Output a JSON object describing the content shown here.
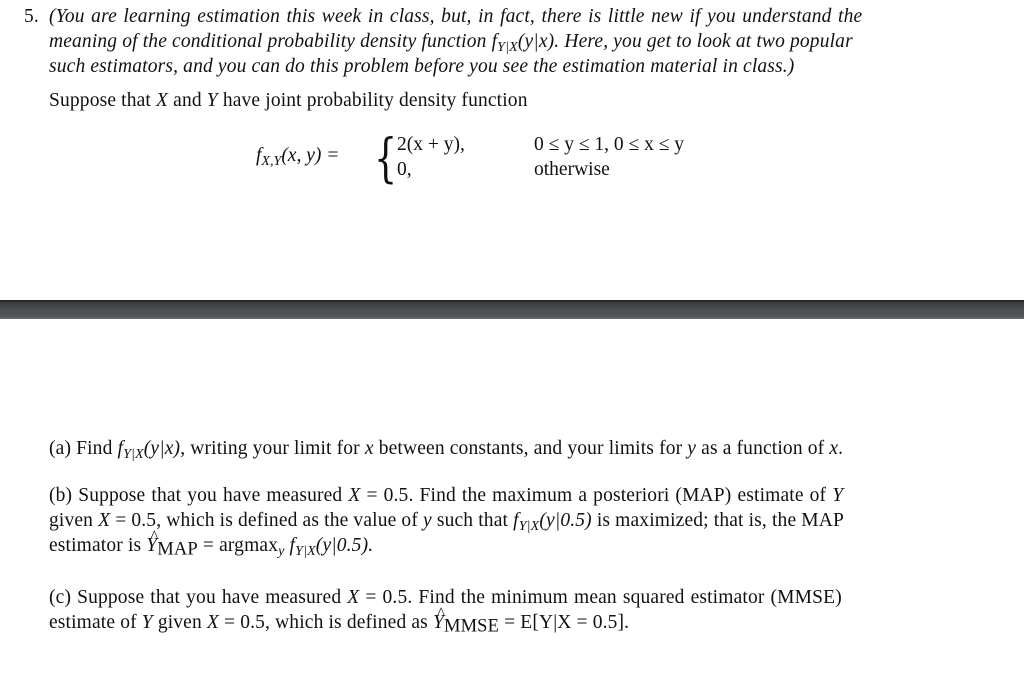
{
  "problem": {
    "number": "5.",
    "intro_lines": [
      "(You are learning estimation this week in class, but, in fact, there is little new if you understand the",
      "meaning of the conditional probability density function",
      ". Here, you get to look at two popular",
      "such estimators, and you can do this problem before you see the estimation material in class.)"
    ],
    "cond_pdf": "f",
    "cond_pdf_sub": "Y|X",
    "cond_pdf_args": "(y|x)",
    "suppose_text": "Suppose that",
    "var_x": "X",
    "and_text": "and",
    "var_y": "Y",
    "joint_text": "have joint probability density function",
    "equation": {
      "lhs_f": "f",
      "lhs_sub": "X,Y",
      "lhs_args": "(x, y) =",
      "case1_expr": "2(x + y),",
      "case1_cond": "0 ≤ y ≤ 1, 0 ≤ x ≤ y",
      "case2_expr": "0,",
      "case2_cond": "otherwise"
    }
  },
  "parts": {
    "a": {
      "label": "(a) Find",
      "f": "f",
      "sub": "Y|X",
      "args": "(y|x)",
      "rest1": ", writing your limit for",
      "x": "x",
      "rest2": "between constants, and your limits for",
      "y": "y",
      "rest3": "as a function of",
      "x2": "x",
      "end": "."
    },
    "b": {
      "line1_a": "(b) Suppose that you have measured",
      "X": "X",
      "line1_b": "= 0.5.  Find the maximum a posteriori (MAP) estimate of",
      "Y": "Y",
      "line2_a": "given",
      "line2_X": "X",
      "line2_b": "= 0.5, which is defined as the value of",
      "line2_y": "y",
      "line2_c": "such that",
      "line2_f": "f",
      "line2_sub": "Y|X",
      "line2_args": "(y|0.5)",
      "line2_d": "is maximized; that is, the MAP",
      "line3_a": "estimator is",
      "line3_Y": "Y",
      "line3_sub": "MAP",
      "line3_b": "= argmax",
      "line3_y": "y",
      "line3_f": "f",
      "line3_fsub": "Y|X",
      "line3_args": "(y|0.5)."
    },
    "c": {
      "line1_a": "(c) Suppose that you have measured",
      "X": "X",
      "line1_b": "= 0.5.  Find the minimum mean squared estimator (MMSE)",
      "line2_a": "estimate of",
      "line2_Y": "Y",
      "line2_b": "given",
      "line2_X": "X",
      "line2_c": "= 0.5, which is defined as",
      "line2_hatY": "Y",
      "line2_sub": "MMSE",
      "line2_d": "= E[Y|X = 0.5]."
    }
  }
}
